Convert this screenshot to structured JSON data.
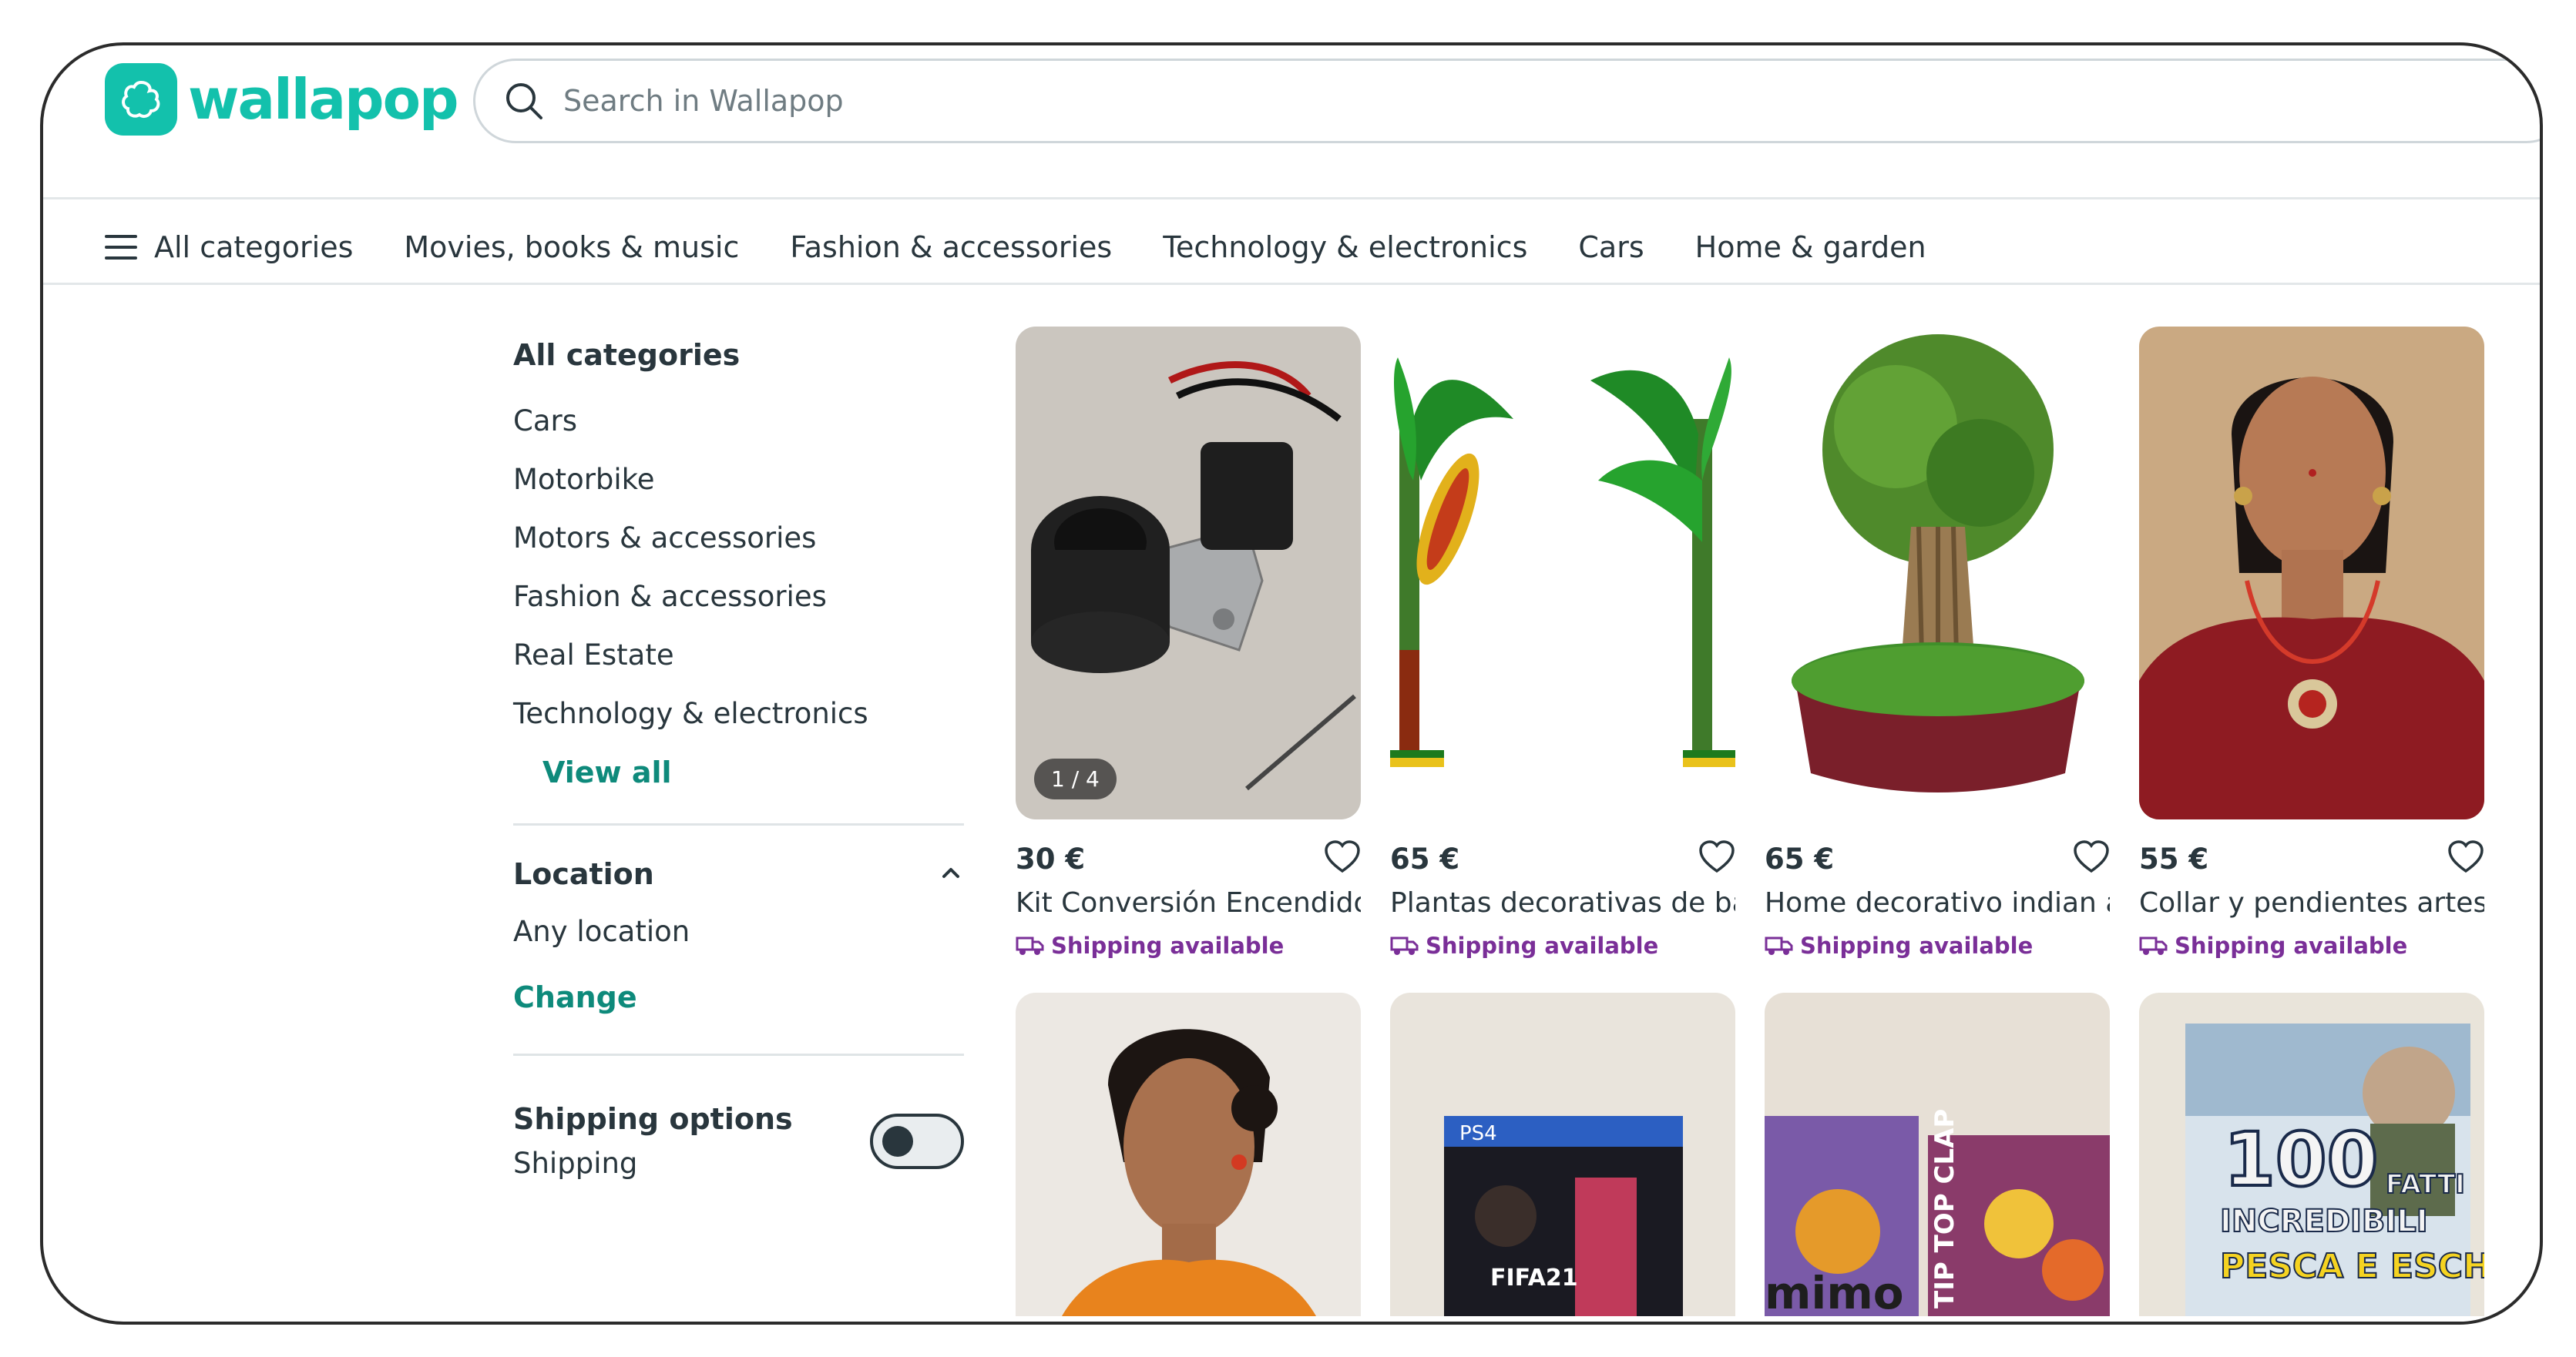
{
  "brand": {
    "name": "wallapop",
    "accent": "#13c1ac",
    "link_color": "#0e8a7b",
    "shipping_color": "#7a2f98"
  },
  "search": {
    "placeholder": "Search in Wallapop"
  },
  "nav": {
    "all_categories": "All categories",
    "items": [
      "Movies, books & music",
      "Fashion & accessories",
      "Technology & electronics",
      "Cars",
      "Home & garden"
    ]
  },
  "sidebar": {
    "heading": "All categories",
    "categories": [
      "Cars",
      "Motorbike",
      "Motors & accessories",
      "Fashion & accessories",
      "Real Estate",
      "Technology & electronics"
    ],
    "view_all": "View all",
    "location": {
      "heading": "Location",
      "value": "Any location",
      "change": "Change"
    },
    "shipping": {
      "title": "Shipping options",
      "subtitle": "Shipping",
      "enabled": false
    }
  },
  "products_row1": [
    {
      "price": "30 €",
      "title": "Kit Conversión Encendido ...",
      "shipping": "Shipping available",
      "pager": "1 / 4"
    },
    {
      "price": "65 €",
      "title": "Plantas decorativas de ba...",
      "shipping": "Shipping available"
    },
    {
      "price": "65 €",
      "title": "Home decorativo indian a...",
      "shipping": "Shipping available"
    },
    {
      "price": "55 €",
      "title": "Collar y pendientes artesa...",
      "shipping": "Shipping available"
    }
  ],
  "products_row2_images": [
    "woman-portrait",
    "fifa21-ps4-game",
    "kids-card-games",
    "book-100-fatti-incredibili"
  ],
  "product_image_text": {
    "ps4": "PS4",
    "fifa": "FIFA21",
    "book_number": "100",
    "book_fatti": "FATTI",
    "book_incredibili": "INCREDIBILI",
    "book_pesca": "PESCA E ESCHE",
    "game_mimo": "mimo",
    "game_tip": "TIP TOP CLAP"
  }
}
